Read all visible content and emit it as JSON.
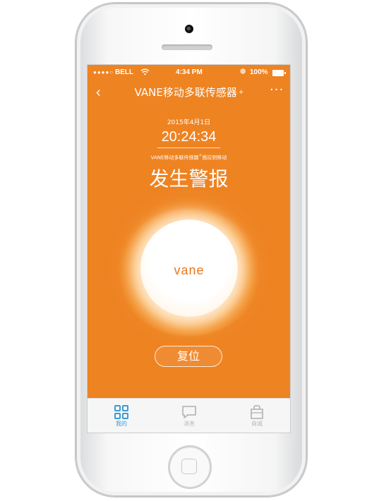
{
  "status_bar": {
    "signal": "●●●●○",
    "carrier": "BELL",
    "wifi_icon": "wifi-icon",
    "time": "4:34 PM",
    "lock_icon": "rotation-lock-icon",
    "battery": "100%"
  },
  "navigation": {
    "back": "‹",
    "title": "VANE移动多联传感器",
    "title_mark": "+",
    "more": "···"
  },
  "alert": {
    "date": "2015年4月1日",
    "time": "20:24:34",
    "sensor_status": "VANE移动多联传感器",
    "sensor_status_mark": "+",
    "sensor_status_suffix": "感应到移动",
    "title": "发生警报",
    "device_logo": "vane",
    "reset_button": "复位"
  },
  "tabs": [
    {
      "label": "我的",
      "icon": "grid-icon",
      "active": true
    },
    {
      "label": "消息",
      "icon": "message-icon",
      "active": false
    },
    {
      "label": "商城",
      "icon": "shopping-bag-icon",
      "active": false
    }
  ],
  "colors": {
    "accent": "#ee8322",
    "active_tab": "#3d9bd9",
    "inactive_tab": "#b8b8b8"
  }
}
